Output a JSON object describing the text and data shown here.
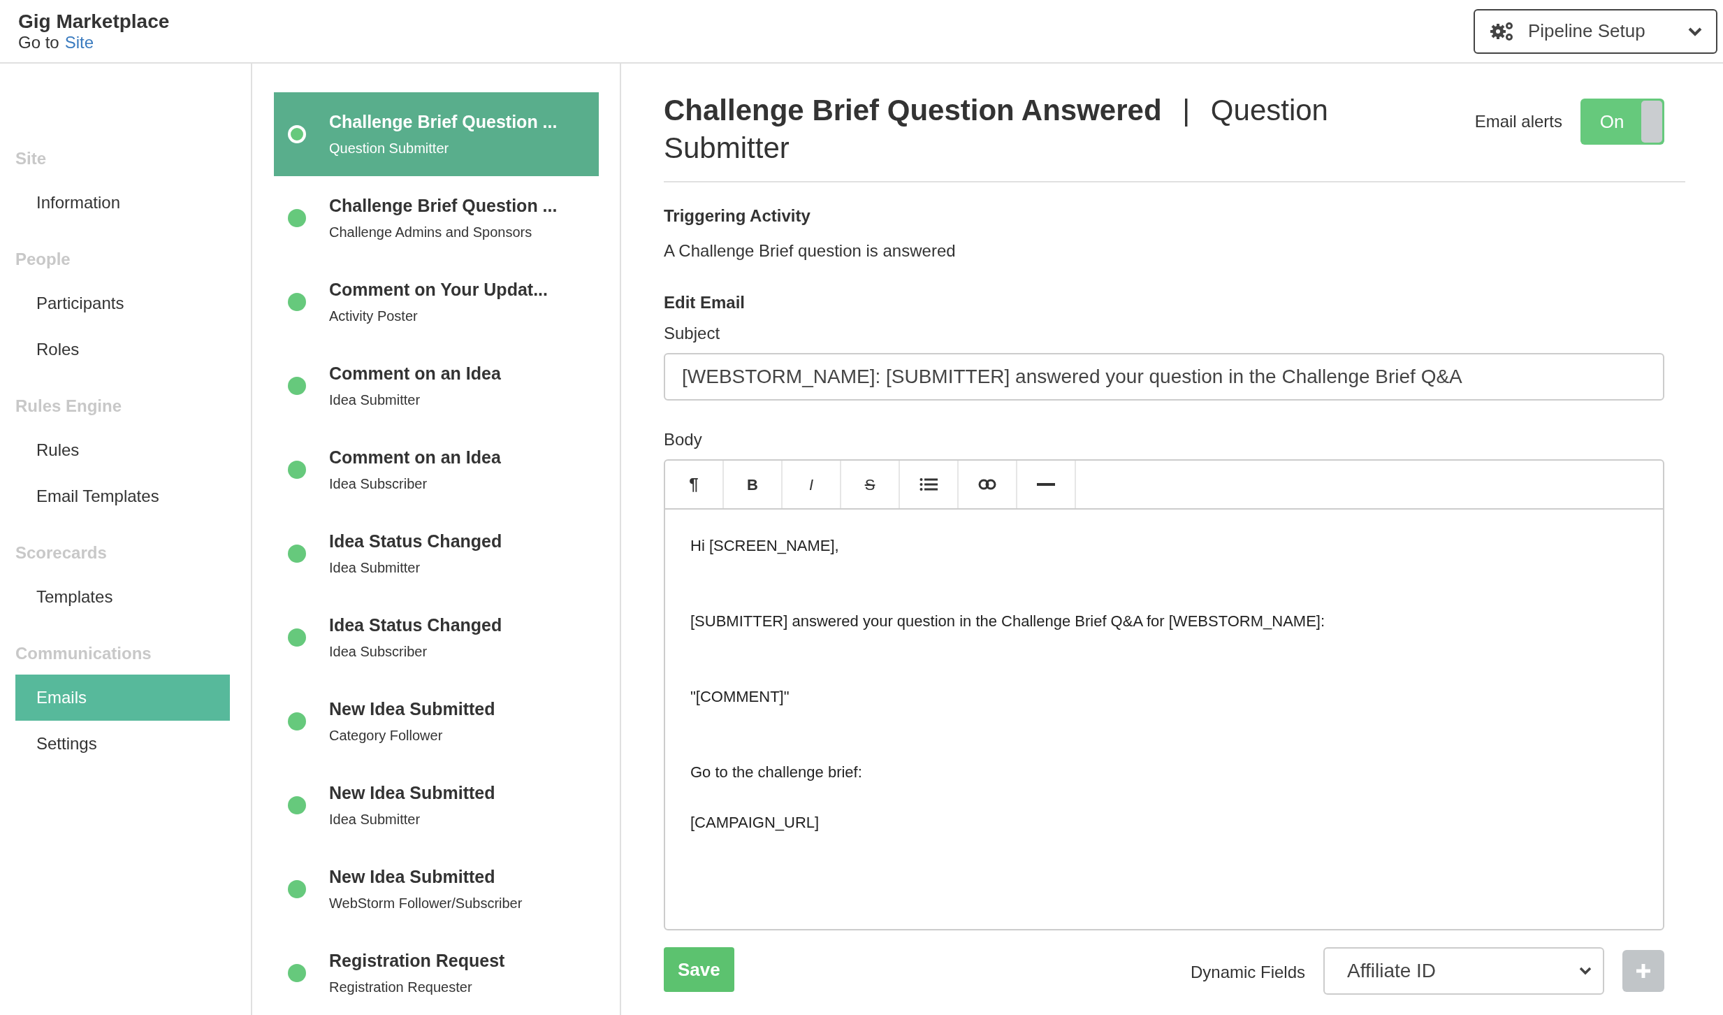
{
  "header": {
    "title": "Gig Marketplace",
    "goto_prefix": "Go to",
    "goto_link": "Site",
    "menu_button": "Pipeline Setup"
  },
  "sidebar": {
    "groups": [
      {
        "heading": "Site",
        "items": [
          {
            "label": "Information",
            "selected": false
          }
        ]
      },
      {
        "heading": "People",
        "items": [
          {
            "label": "Participants",
            "selected": false
          },
          {
            "label": "Roles",
            "selected": false
          }
        ]
      },
      {
        "heading": "Rules Engine",
        "items": [
          {
            "label": "Rules",
            "selected": false
          },
          {
            "label": "Email Templates",
            "selected": false
          }
        ]
      },
      {
        "heading": "Scorecards",
        "items": [
          {
            "label": "Templates",
            "selected": false
          }
        ]
      },
      {
        "heading": "Communications",
        "items": [
          {
            "label": "Emails",
            "selected": true
          },
          {
            "label": "Settings",
            "selected": false
          }
        ]
      }
    ]
  },
  "email_list": [
    {
      "title": "Challenge Brief Question ...",
      "subtitle": "Question Submitter",
      "selected": true
    },
    {
      "title": "Challenge Brief Question ...",
      "subtitle": "Challenge Admins and Sponsors",
      "selected": false
    },
    {
      "title": "Comment on Your Updat...",
      "subtitle": "Activity Poster",
      "selected": false
    },
    {
      "title": "Comment on an Idea",
      "subtitle": "Idea Submitter",
      "selected": false
    },
    {
      "title": "Comment on an Idea",
      "subtitle": "Idea Subscriber",
      "selected": false
    },
    {
      "title": "Idea Status Changed",
      "subtitle": "Idea Submitter",
      "selected": false
    },
    {
      "title": "Idea Status Changed",
      "subtitle": "Idea Subscriber",
      "selected": false
    },
    {
      "title": "New Idea Submitted",
      "subtitle": "Category Follower",
      "selected": false
    },
    {
      "title": "New Idea Submitted",
      "subtitle": "Idea Submitter",
      "selected": false
    },
    {
      "title": "New Idea Submitted",
      "subtitle": "WebStorm Follower/Subscriber",
      "selected": false
    },
    {
      "title": "Registration Request",
      "subtitle": "Registration Requester",
      "selected": false
    }
  ],
  "editor": {
    "title": "Challenge Brief Question Answered",
    "separator": "|",
    "title_suffix": "Question Submitter",
    "email_alerts_label": "Email alerts",
    "email_alerts": {
      "on": true,
      "label": "On"
    },
    "triggering_heading": "Triggering Activity",
    "triggering_text": "A Challenge Brief question is answered",
    "edit_heading": "Edit Email",
    "subject_label": "Subject",
    "subject_value": "[WEBSTORM_NAME]: [SUBMITTER] answered your question in the Challenge Brief Q&A",
    "body_label": "Body",
    "toolbar": [
      {
        "kind": "paragraph",
        "label": "¶"
      },
      {
        "kind": "bold",
        "label": "B"
      },
      {
        "kind": "italic",
        "label": "I"
      },
      {
        "kind": "strike",
        "label": "S"
      },
      {
        "kind": "list"
      },
      {
        "kind": "link"
      },
      {
        "kind": "rule"
      }
    ],
    "body_paragraphs": [
      [
        "Hi [SCREEN_NAME],"
      ],
      [
        "[SUBMITTER] answered your question in the Challenge Brief Q&A for [WEBSTORM_NAME]:"
      ],
      [
        "\"[COMMENT]\""
      ],
      [
        "Go to the challenge brief:",
        "[CAMPAIGN_URL]"
      ]
    ],
    "save_button": "Save",
    "dynamic_fields_label": "Dynamic Fields",
    "dynamic_fields_value": "Affiliate ID"
  }
}
